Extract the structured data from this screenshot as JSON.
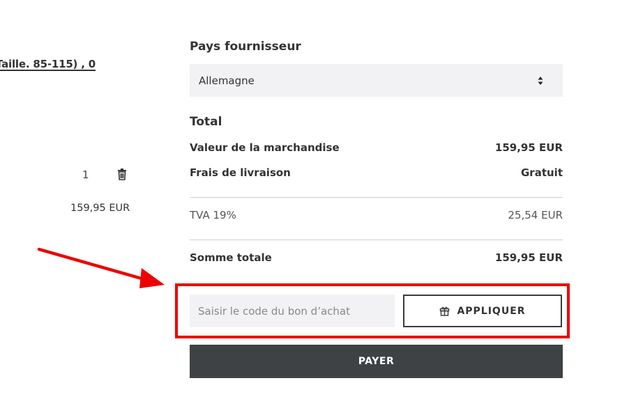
{
  "cart_item": {
    "title_fragment": "Taille. 85-115) , 0",
    "quantity": "1",
    "price": "159,95 EUR"
  },
  "supplier": {
    "label": "Pays fournisseur",
    "selected_country": "Allemagne"
  },
  "summary": {
    "title": "Total",
    "goods_value_label": "Valeur de la marchandise",
    "goods_value": "159,95 EUR",
    "shipping_label": "Frais de livraison",
    "shipping_value": "Gratuit",
    "vat_label": "TVA 19%",
    "vat_value": "25,54 EUR",
    "grand_total_label": "Somme totale",
    "grand_total_value": "159,95 EUR"
  },
  "voucher": {
    "placeholder": "Saisir le code du bon d’achat",
    "apply_label": "APPLIQUER"
  },
  "pay_label": "PAYER",
  "colors": {
    "highlight": "#ee0000",
    "pay_button": "#3f4245",
    "field_bg": "#f2f2f4"
  },
  "icons": [
    "trash-icon",
    "select-arrows-icon",
    "gift-icon",
    "annotation-arrow"
  ]
}
